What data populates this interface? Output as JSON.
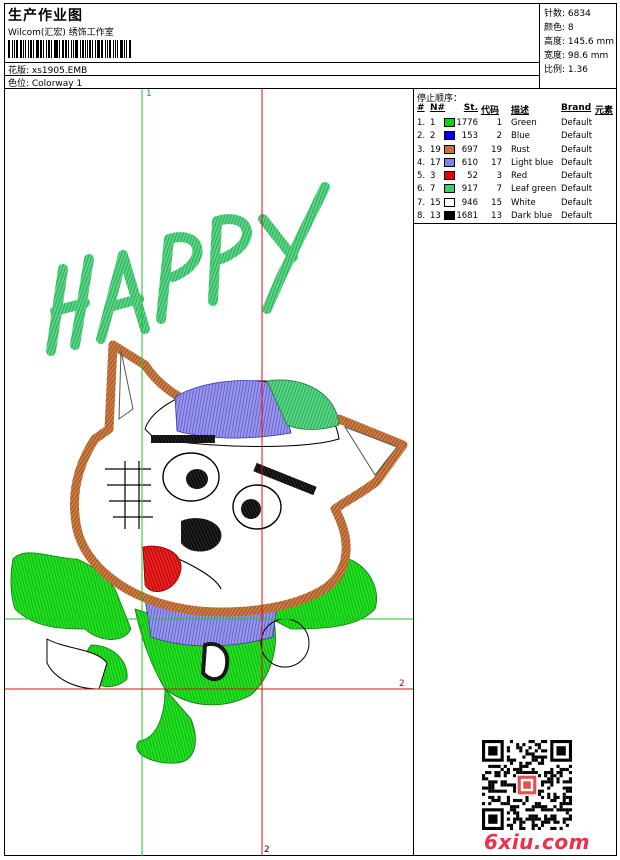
{
  "header": {
    "title": "生产作业图",
    "studio": "Wilcom(汇宏) 绣饰工作室",
    "design_label": "花版: xs1905.EMB",
    "colorway_label": "色位:  Colorway 1"
  },
  "specs": {
    "stitches": "针数: 6834",
    "colors": "颜色: 8",
    "height": "高度: 145.6 mm",
    "width": "宽度: 98.6 mm",
    "scale": "比例: 1.36"
  },
  "sequence": {
    "title": "停止顺序：",
    "headers": [
      "#",
      "N#",
      "St.",
      "代码",
      "描述",
      "Brand",
      "元素"
    ],
    "rows": [
      {
        "idx": "1.",
        "no": "1",
        "color": "#00d800",
        "st": "1776",
        "code": "1",
        "desc": "Green",
        "brand": "Default"
      },
      {
        "idx": "2.",
        "no": "2",
        "color": "#0000e0",
        "st": "153",
        "code": "2",
        "desc": "Blue",
        "brand": "Default"
      },
      {
        "idx": "3.",
        "no": "19",
        "color": "#c8703a",
        "st": "697",
        "code": "19",
        "desc": "Rust",
        "brand": "Default"
      },
      {
        "idx": "4.",
        "no": "17",
        "color": "#8080ee",
        "st": "610",
        "code": "17",
        "desc": "Light blue",
        "brand": "Default"
      },
      {
        "idx": "5.",
        "no": "3",
        "color": "#e80000",
        "st": "52",
        "code": "3",
        "desc": "Red",
        "brand": "Default"
      },
      {
        "idx": "6.",
        "no": "7",
        "color": "#3dcc6a",
        "st": "917",
        "code": "7",
        "desc": "Leaf green",
        "brand": "Default"
      },
      {
        "idx": "7.",
        "no": "15",
        "color": "#ffffff",
        "st": "946",
        "code": "15",
        "desc": "White",
        "brand": "Default"
      },
      {
        "idx": "8.",
        "no": "13",
        "color": "#000000",
        "st": "1681",
        "code": "13",
        "desc": "Dark blue",
        "brand": "Default"
      }
    ]
  },
  "design": {
    "text": "HAPPY",
    "marker_1": "1",
    "marker_2": "2",
    "marker_2b": "2"
  },
  "watermark": "6xiu.com",
  "colors": {
    "green": "#22e022",
    "leaf_green": "#3cc86e",
    "rust": "#c27038",
    "light_blue": "#8a86e6",
    "red": "#e8141a",
    "guide_green": "#22c422",
    "guide_red": "#e01010",
    "logo": "#ef2e4a"
  }
}
